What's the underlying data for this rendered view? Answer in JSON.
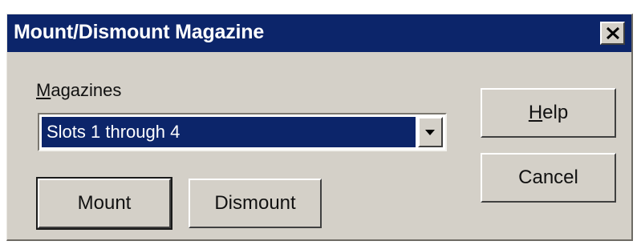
{
  "dialog": {
    "title": "Mount/Dismount Magazine",
    "close_icon": "close-x-icon"
  },
  "magazines": {
    "label_mnemonic": "M",
    "label_rest": "agazines",
    "selected_value": "Slots 1 through 4",
    "dropdown_icon": "chevron-down-icon"
  },
  "buttons": {
    "mount": "Mount",
    "dismount": "Dismount",
    "help_mnemonic": "H",
    "help_rest": "elp",
    "cancel": "Cancel"
  }
}
